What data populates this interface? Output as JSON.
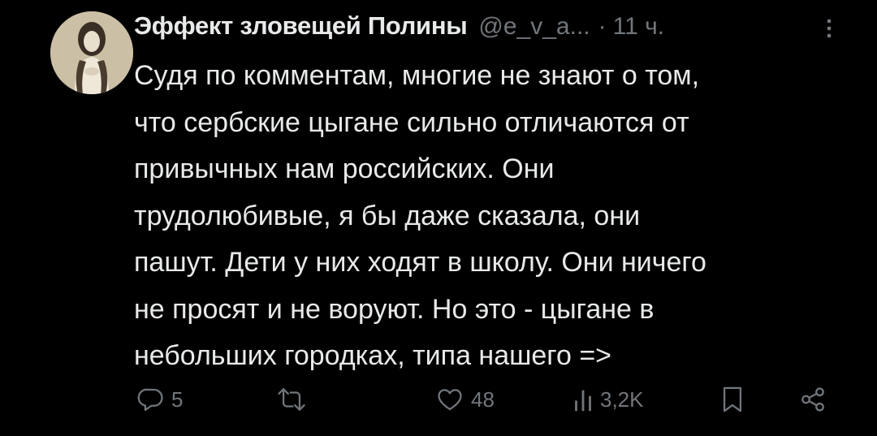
{
  "tweet": {
    "author": {
      "display_name": "Эффект зловещей Полины",
      "handle": "@e_v_a...",
      "separator": "·",
      "time": "11 ч."
    },
    "text": "Судя по комментам, многие не знают о том,\nчто сербские цыгане сильно отличаются от\nпривычных нам российских. Они\nтрудолюбивые, я бы даже сказала, они\nпашут. Дети у них ходят в школу. Они ничего\nне просят и не воруют. Но это - цыгане в\nнебольших городках, типа нашего =>",
    "actions": {
      "reply": {
        "icon": "reply-icon",
        "count": "5"
      },
      "retweet": {
        "icon": "retweet-icon",
        "count": ""
      },
      "like": {
        "icon": "heart-icon",
        "count": "48"
      },
      "views": {
        "icon": "views-icon",
        "count": "3,2K"
      },
      "bookmark": {
        "icon": "bookmark-icon"
      },
      "share": {
        "icon": "share-icon"
      }
    }
  },
  "colors": {
    "background": "#000000",
    "text": "#e7e9ea",
    "muted": "#71767b"
  }
}
